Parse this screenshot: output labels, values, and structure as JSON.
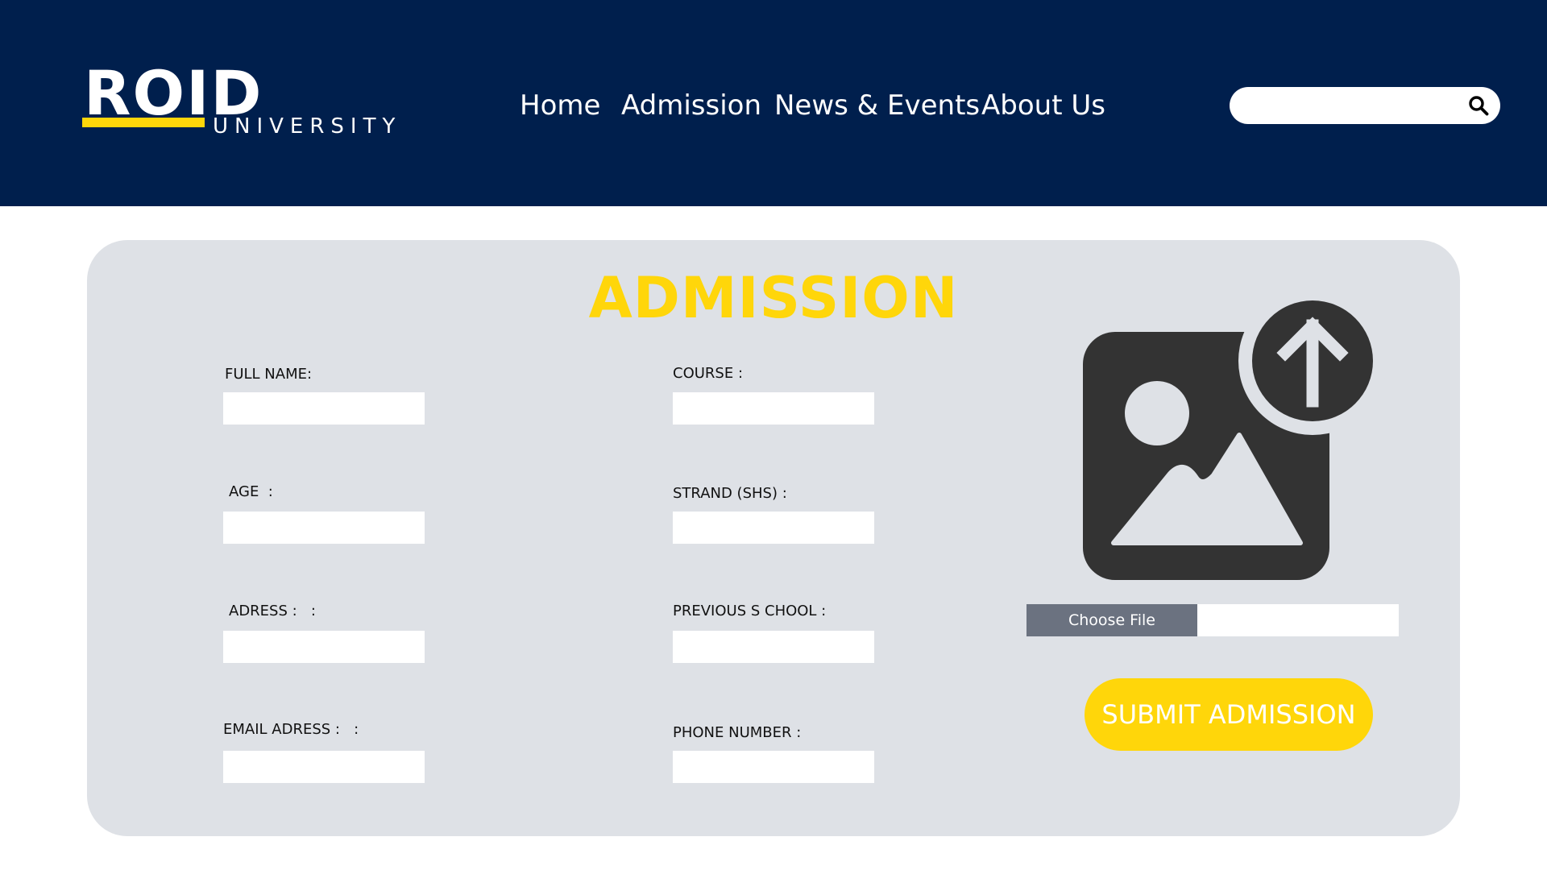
{
  "header": {
    "background_color": "#001f4d",
    "logo": {
      "wordmark": "ROID",
      "subtitle": "UNIVERSITY",
      "accent_color": "#ffd60a"
    },
    "nav": [
      {
        "label": "Home"
      },
      {
        "label": "Admission"
      },
      {
        "label": "News & Events"
      },
      {
        "label": "About Us"
      }
    ],
    "search": {
      "value": "",
      "icon": "search-icon"
    }
  },
  "form": {
    "title": "ADMISSION",
    "title_color": "#ffd60a",
    "fields_left": [
      {
        "label": "FULL NAME:",
        "value": ""
      },
      {
        "label": "AGE  :",
        "value": ""
      },
      {
        "label": "ADRESS :   :",
        "value": ""
      },
      {
        "label": "EMAIL ADRESS :   :",
        "value": ""
      }
    ],
    "fields_right": [
      {
        "label": "COURSE :",
        "value": ""
      },
      {
        "label": "STRAND (SHS) :",
        "value": ""
      },
      {
        "label": "PREVIOUS S CHOOL :",
        "value": ""
      },
      {
        "label": "PHONE NUMBER :",
        "value": ""
      }
    ],
    "upload": {
      "icon": "image-upload-icon",
      "choose_file_label": "Choose File",
      "file_name": ""
    },
    "submit_label": "SUBMIT ADMISSION",
    "submit_color": "#ffd60a"
  }
}
